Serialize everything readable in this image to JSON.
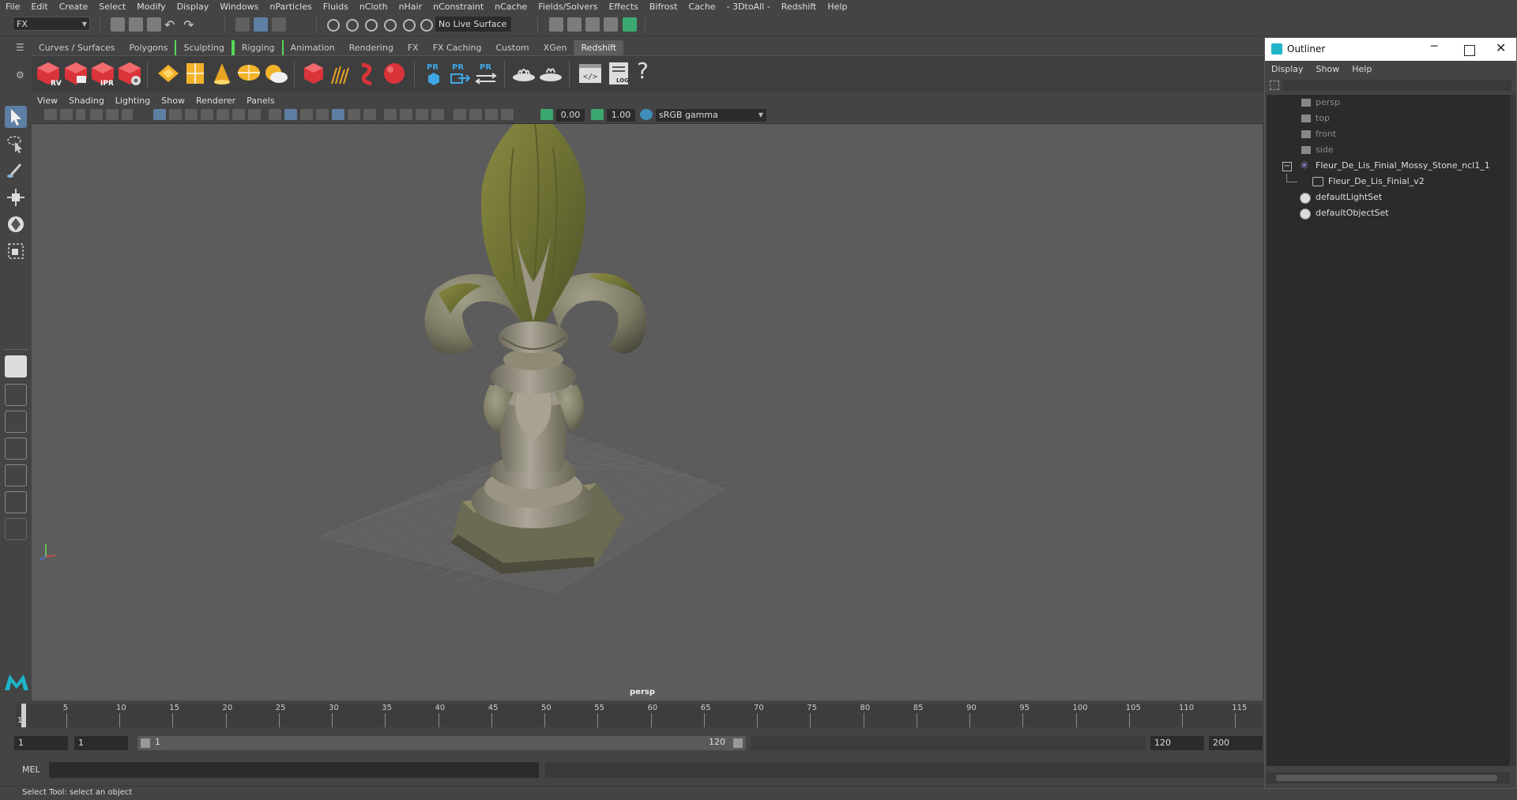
{
  "menubar": {
    "items": [
      "File",
      "Edit",
      "Create",
      "Select",
      "Modify",
      "Display",
      "Windows",
      "nParticles",
      "Fluids",
      "nCloth",
      "nHair",
      "nConstraint",
      "nCache",
      "Fields/Solvers",
      "Effects",
      "Bifrost",
      "Cache",
      "- 3DtoAll -",
      "Redshift",
      "Help"
    ]
  },
  "statusline": {
    "mode": "FX",
    "live_surface": "No Live Surface"
  },
  "shelf": {
    "tabs": [
      "Curves / Surfaces",
      "Polygons",
      "Sculpting",
      "Rigging",
      "Animation",
      "Rendering",
      "FX",
      "FX Caching",
      "Custom",
      "XGen",
      "Redshift"
    ],
    "active_tab": "Redshift",
    "icon_labels": {
      "rv": "RV",
      "ipr": "IPR",
      "pr1": "PR",
      "pr2": "PR",
      "pr3": "PR",
      "log": "LOG",
      "help": "?"
    }
  },
  "viewport": {
    "menu": [
      "View",
      "Shading",
      "Lighting",
      "Show",
      "Renderer",
      "Panels"
    ],
    "exposure": "0.00",
    "gamma": "1.00",
    "color_space": "sRGB gamma",
    "camera_label": "persp"
  },
  "timeline": {
    "ticks": [
      "1",
      "5",
      "10",
      "15",
      "20",
      "25",
      "30",
      "35",
      "40",
      "45",
      "50",
      "55",
      "60",
      "65",
      "70",
      "75",
      "80",
      "85",
      "90",
      "95",
      "100",
      "105",
      "110",
      "115"
    ],
    "current_frame": "1"
  },
  "range": {
    "start": "1",
    "playback_start": "1",
    "slider_start": "1",
    "slider_end": "120",
    "playback_end": "120",
    "end": "200"
  },
  "mel": {
    "label": "MEL"
  },
  "helpline": {
    "text": "Select Tool: select an object"
  },
  "outliner": {
    "title": "Outliner",
    "menu": [
      "Display",
      "Show",
      "Help"
    ],
    "items": [
      {
        "label": "persp",
        "kind": "camera",
        "indent": 0
      },
      {
        "label": "top",
        "kind": "camera",
        "indent": 0
      },
      {
        "label": "front",
        "kind": "camera",
        "indent": 0
      },
      {
        "label": "side",
        "kind": "camera",
        "indent": 0
      },
      {
        "label": "Fleur_De_Lis_Finial_Mossy_Stone_ncl1_1",
        "kind": "group",
        "indent": 0
      },
      {
        "label": "Fleur_De_Lis_Finial_v2",
        "kind": "mesh",
        "indent": 1
      },
      {
        "label": "defaultLightSet",
        "kind": "set",
        "indent": 0
      },
      {
        "label": "defaultObjectSet",
        "kind": "set",
        "indent": 0
      }
    ]
  },
  "colors": {
    "accent": "#5d7fa3",
    "shelf_bracket": "#57d957",
    "redshift_red": "#d9343a",
    "viewport_bg": "#5c5c5c",
    "moss": "#7c8038",
    "stone": "#9b9687"
  }
}
